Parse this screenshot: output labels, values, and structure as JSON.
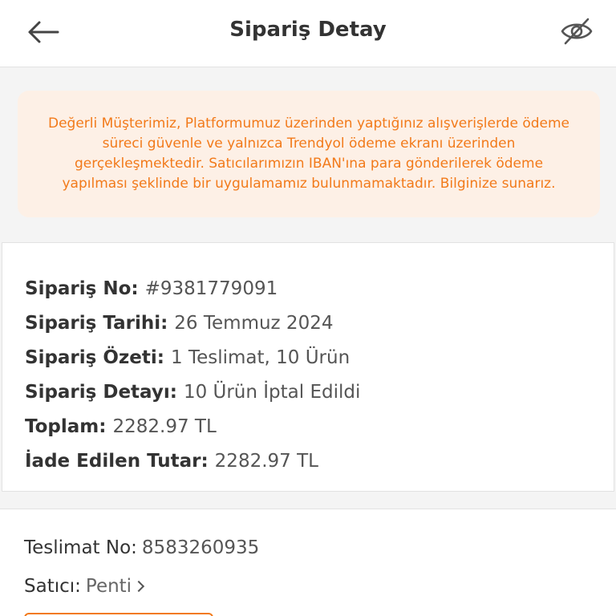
{
  "header": {
    "title": "Sipariş Detay",
    "back_icon": "arrow-left-icon",
    "visibility_icon": "eye-off-icon"
  },
  "notice": {
    "text": "Değerli Müşterimiz, Platformumuz üzerinden yaptığınız alışverişlerde ödeme süreci güvenle ve yalnızca Trendyol ödeme ekranı üzerinden gerçekleşmektedir. Satıcılarımızın IBAN'ına para gönderilerek ödeme yapılması şeklinde bir uygulamamız bulunmamaktadır. Bilginize sunarız."
  },
  "order": {
    "number_label": "Sipariş No:",
    "number_value": "#9381779091",
    "date_label": "Sipariş Tarihi:",
    "date_value": "26 Temmuz 2024",
    "summary_label": "Sipariş Özeti:",
    "summary_deliveries": "1 Teslimat",
    "summary_sep": ", ",
    "summary_items": "10 Ürün",
    "detail_label": "Sipariş Detayı:",
    "detail_value": "10 Ürün İptal Edildi",
    "total_label": "Toplam:",
    "total_value": "2282.97 TL",
    "refund_label": "İade Edilen Tutar:",
    "refund_value": "2282.97 TL"
  },
  "delivery": {
    "number_label": "Teslimat No:",
    "number_value": "8583260935",
    "seller_label": "Satıcı:",
    "seller_value": "Penti"
  },
  "colors": {
    "accent": "#f27a1a",
    "success": "#0bc15c",
    "danger": "#d0021b",
    "notice_bg": "#fdf0e6"
  }
}
